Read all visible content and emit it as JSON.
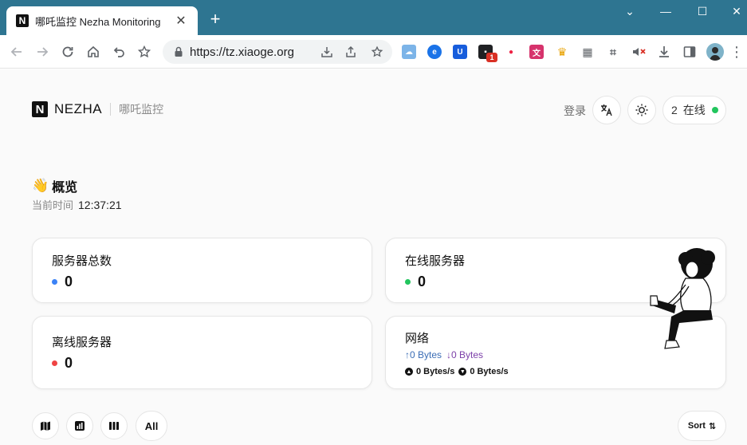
{
  "browser": {
    "tab": {
      "favicon": "N",
      "title": "哪吒监控 Nezha Monitoring",
      "close": "✕"
    },
    "new_tab": "+",
    "window_controls": {
      "minimize": "—",
      "maximize": "☐",
      "close": "✕",
      "chevron": "⌄"
    },
    "address": {
      "url": "https://tz.xiaoge.org"
    },
    "extension_badge": "1"
  },
  "header": {
    "logo_letter": "N",
    "brand": "NEZHA",
    "subtitle": "哪吒监控",
    "login": "登录",
    "online_count": "2",
    "online_label": "在线"
  },
  "overview": {
    "emoji": "👋",
    "title": "概览",
    "time_label": "当前时间",
    "time_value": "12:37:21"
  },
  "cards": {
    "total": {
      "label": "服务器总数",
      "value": "0"
    },
    "online": {
      "label": "在线服务器",
      "value": "0"
    },
    "offline": {
      "label": "离线服务器",
      "value": "0"
    },
    "network": {
      "label": "网络",
      "upload": "↑0 Bytes",
      "download": "↓0 Bytes",
      "upload_speed": "0 Bytes/s",
      "download_speed": "0 Bytes/s"
    }
  },
  "controls": {
    "all": "All",
    "sort": "Sort",
    "sort_icon": "⇅"
  },
  "colors": {
    "titlebar": "#2e7591",
    "total_dot": "#3b82f6",
    "online_dot": "#22c55e",
    "offline_dot": "#ef4444",
    "upload_text": "#3b6db5",
    "download_text": "#7b3fa8"
  }
}
